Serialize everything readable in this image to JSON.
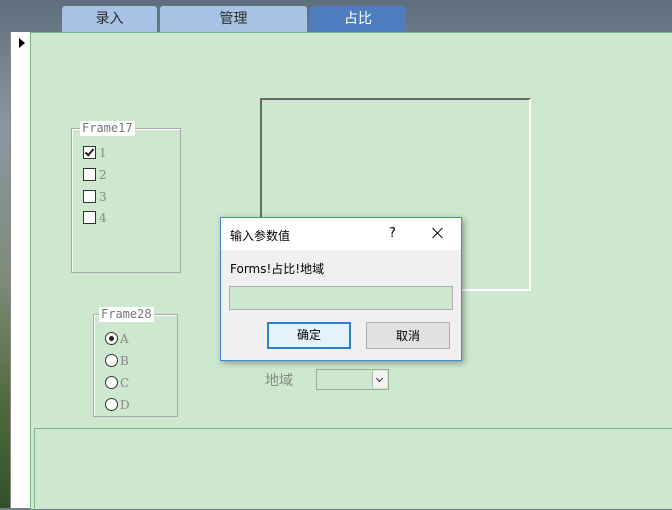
{
  "tabs": [
    {
      "label": "录入",
      "active": false
    },
    {
      "label": "管理",
      "active": false
    },
    {
      "label": "占比",
      "active": true
    }
  ],
  "frame17": {
    "title": "Frame17",
    "options": [
      {
        "label": "1",
        "checked": true
      },
      {
        "label": "2",
        "checked": false
      },
      {
        "label": "3",
        "checked": false
      },
      {
        "label": "4",
        "checked": false
      }
    ]
  },
  "frame28": {
    "title": "Frame28",
    "options": [
      {
        "label": "A",
        "checked": true
      },
      {
        "label": "B",
        "checked": false
      },
      {
        "label": "C",
        "checked": false
      },
      {
        "label": "D",
        "checked": false
      }
    ]
  },
  "region": {
    "label": "地域",
    "value": ""
  },
  "dialog": {
    "title": "输入参数值",
    "help": "?",
    "prompt": "Forms!占比!地域",
    "value": "",
    "ok_label": "确定",
    "cancel_label": "取消"
  },
  "colors": {
    "form_bg": "#cde8cf",
    "tab": "#a7c2e4",
    "tab_active": "#4e7dbf",
    "dialog_border": "#3c8bd4"
  }
}
